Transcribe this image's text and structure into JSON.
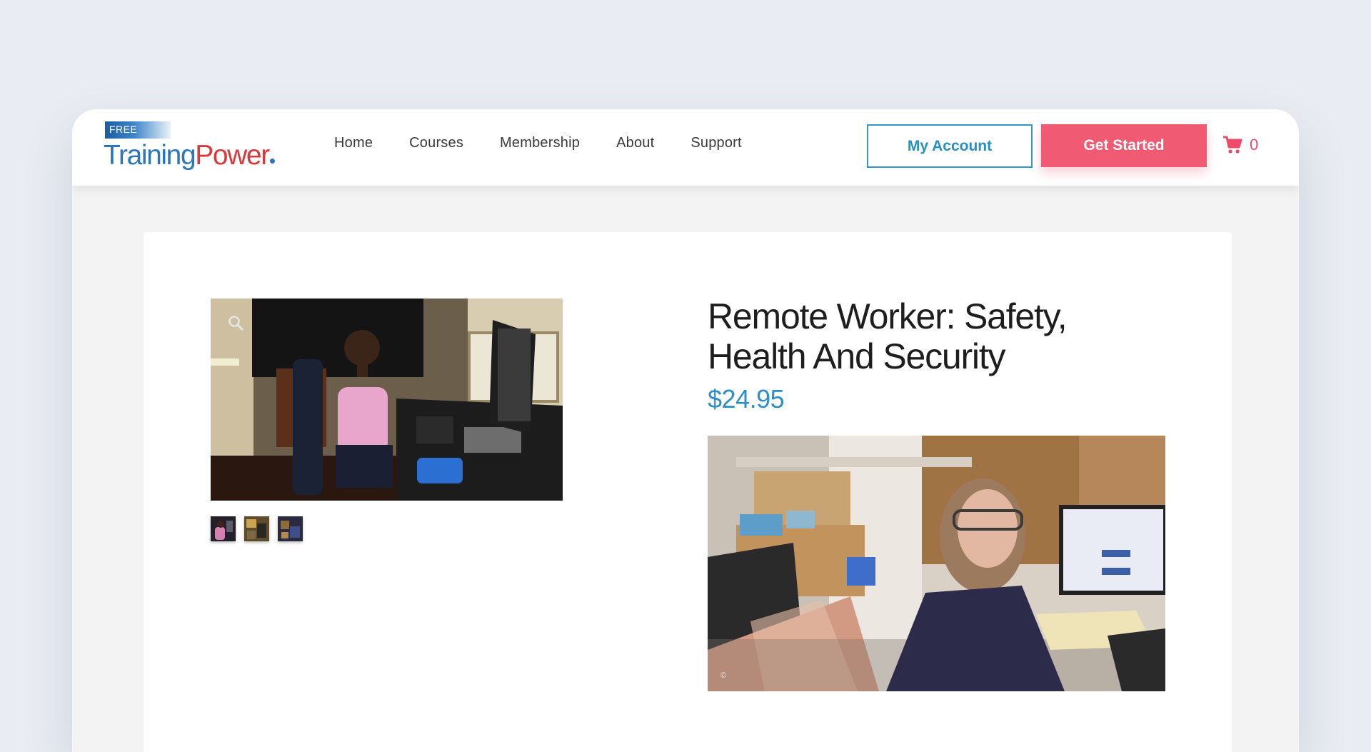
{
  "logo": {
    "free": "FREE",
    "training": "Training",
    "power": "Power"
  },
  "nav": {
    "items": [
      "Home",
      "Courses",
      "Membership",
      "About",
      "Support"
    ]
  },
  "header": {
    "account_label": "My Account",
    "cta_label": "Get Started",
    "cart_count": "0"
  },
  "product": {
    "title": "Remote Worker: Safety, Health And Security",
    "price": "$24.95"
  },
  "colors": {
    "brand_blue": "#2a76bd",
    "brand_red": "#d63a3a",
    "accent_pink": "#f05a73",
    "price_blue": "#2d8fc6"
  },
  "icons": [
    "zoom-icon",
    "cart-icon"
  ]
}
